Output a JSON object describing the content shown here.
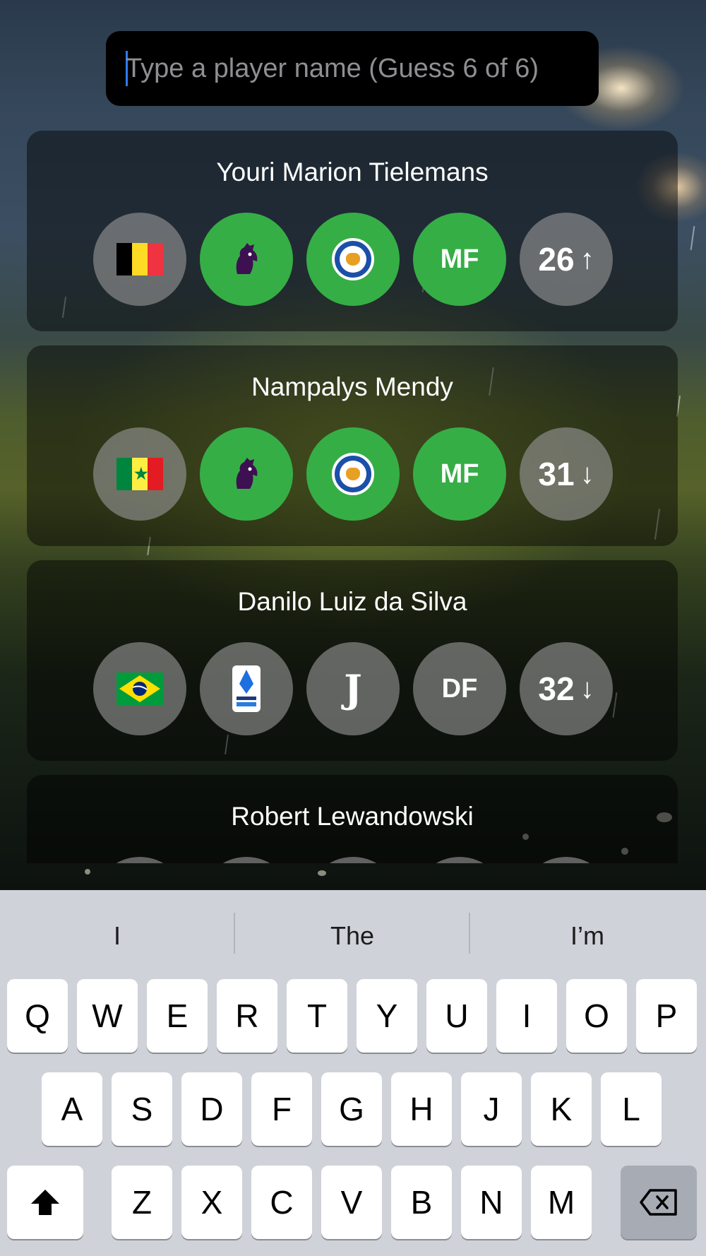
{
  "search": {
    "placeholder": "Type a player name (Guess 6 of 6)"
  },
  "guesses": [
    {
      "name": "Youri Marion Tielemans",
      "nationality_flag": "belgium-flag",
      "nationality_correct": false,
      "league_icon": "premier-league-icon",
      "league_correct": true,
      "club_icon": "leicester-city-crest",
      "club_correct": true,
      "position": "MF",
      "position_correct": true,
      "age": "26",
      "age_hint": "↑",
      "age_correct": false
    },
    {
      "name": "Nampalys Mendy",
      "nationality_flag": "senegal-flag",
      "nationality_correct": false,
      "league_icon": "premier-league-icon",
      "league_correct": true,
      "club_icon": "leicester-city-crest",
      "club_correct": true,
      "position": "MF",
      "position_correct": true,
      "age": "31",
      "age_hint": "↓",
      "age_correct": false
    },
    {
      "name": "Danilo Luiz da Silva",
      "nationality_flag": "brazil-flag",
      "nationality_correct": false,
      "league_icon": "serie-a-icon",
      "league_correct": false,
      "club_icon": "juventus-crest",
      "club_correct": false,
      "position": "DF",
      "position_correct": false,
      "age": "32",
      "age_hint": "↓",
      "age_correct": false
    },
    {
      "name": "Robert Lewandowski"
    }
  ],
  "colors": {
    "correct": "#36ae46",
    "incorrect": "#969696",
    "caret": "#2f7bf6"
  },
  "keyboard": {
    "suggestions": [
      "I",
      "The",
      "I’m"
    ],
    "row1": [
      "Q",
      "W",
      "E",
      "R",
      "T",
      "Y",
      "U",
      "I",
      "O",
      "P"
    ],
    "row2": [
      "A",
      "S",
      "D",
      "F",
      "G",
      "H",
      "J",
      "K",
      "L"
    ],
    "row3": [
      "Z",
      "X",
      "C",
      "V",
      "B",
      "N",
      "M"
    ],
    "shift_icon": "shift-arrow-icon",
    "delete_icon": "backspace-icon"
  }
}
